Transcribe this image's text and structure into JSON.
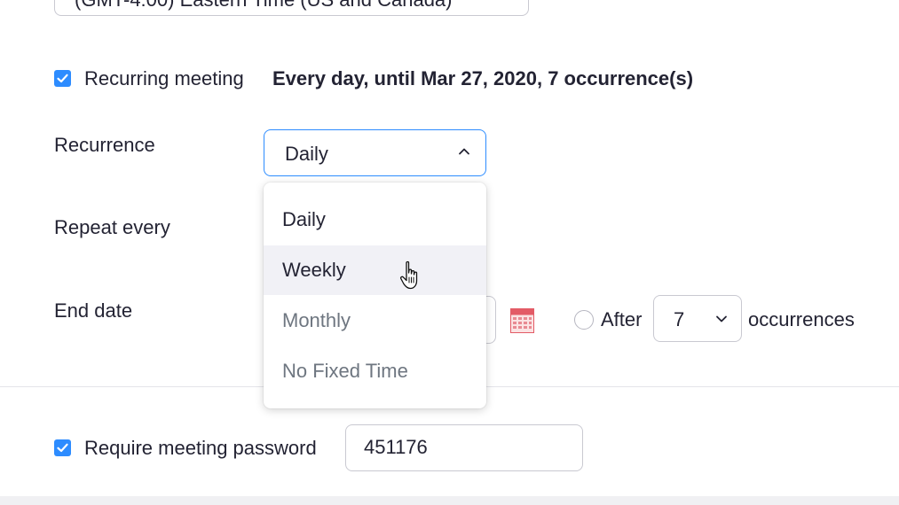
{
  "timezone": {
    "value": "(GMT-4:00) Eastern Time (US and Canada)"
  },
  "recurring": {
    "checked": true,
    "label": "Recurring meeting",
    "summary": "Every day, until Mar 27, 2020, 7 occurrence(s)"
  },
  "recurrence": {
    "label": "Recurrence",
    "selected": "Daily",
    "options": [
      "Daily",
      "Weekly",
      "Monthly",
      "No Fixed Time"
    ],
    "hovered_option": "Weekly"
  },
  "repeat_every": {
    "label": "Repeat every"
  },
  "end_date": {
    "label": "End date",
    "after_label": "After",
    "occurrences_value": "7",
    "occurrences_label": "occurrences"
  },
  "password": {
    "checked": true,
    "label": "Require meeting password",
    "value": "451176"
  },
  "colors": {
    "accent": "#2d8cff",
    "text": "#232333",
    "border": "#c9c9d1"
  },
  "icons": {
    "checkbox": "checkmark-icon",
    "chevron_up": "chevron-up-icon",
    "chevron_down": "chevron-down-icon",
    "calendar": "calendar-icon",
    "cursor": "hand-pointer-icon"
  }
}
